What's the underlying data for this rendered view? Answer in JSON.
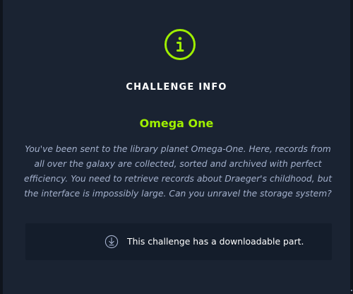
{
  "modal": {
    "icon": "info-icon",
    "heading": "CHALLENGE INFO",
    "challenge_name": "Omega One",
    "description": "You've been sent to the library planet Omega-One. Here, records from all over the galaxy are collected, sorted and archived with perfect efficiency. You need to retrieve records about Draeger's childhood, but the interface is impossibly large. Can you unravel the storage system?",
    "download": {
      "icon": "download-icon",
      "text": "This challenge has a downloadable part."
    }
  },
  "colors": {
    "accent": "#9fef00",
    "modal_background": "#1a2332",
    "panel_background": "#141d2b",
    "page_background": "#0f141d",
    "muted_text": "#a4b1cd",
    "heading_text": "#ffffff"
  }
}
